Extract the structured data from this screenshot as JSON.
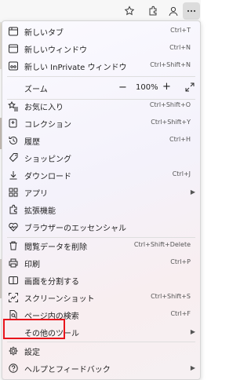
{
  "toolbar": {
    "icons": [
      "favorite-star-icon",
      "extensions-icon",
      "profile-icon",
      "more-menu-icon"
    ]
  },
  "menu": {
    "items": [
      {
        "label": "新しいタブ",
        "shortcut": "Ctrl+T",
        "icon": "new-tab-icon"
      },
      {
        "label": "新しいウィンドウ",
        "shortcut": "Ctrl+N",
        "icon": "new-window-icon"
      },
      {
        "label": "新しい InPrivate ウィンドウ",
        "shortcut": "Ctrl+Shift+N",
        "icon": "inprivate-icon"
      },
      {
        "label": "お気に入り",
        "shortcut": "Ctrl+Shift+O",
        "icon": "favorites-icon"
      },
      {
        "label": "コレクション",
        "shortcut": "Ctrl+Shift+Y",
        "icon": "collections-icon"
      },
      {
        "label": "履歴",
        "shortcut": "Ctrl+H",
        "icon": "history-icon"
      },
      {
        "label": "ショッピング",
        "shortcut": "",
        "icon": "shopping-tag-icon"
      },
      {
        "label": "ダウンロード",
        "shortcut": "Ctrl+J",
        "icon": "download-icon"
      },
      {
        "label": "アプリ",
        "shortcut": "",
        "icon": "apps-icon"
      },
      {
        "label": "拡張機能",
        "shortcut": "",
        "icon": "extensions-icon"
      },
      {
        "label": "ブラウザーのエッセンシャル",
        "shortcut": "",
        "icon": "heart-pulse-icon"
      },
      {
        "label": "閲覧データを削除",
        "shortcut": "Ctrl+Shift+Delete",
        "icon": "trash-icon"
      },
      {
        "label": "印刷",
        "shortcut": "Ctrl+P",
        "icon": "print-icon"
      },
      {
        "label": "画面を分割する",
        "shortcut": "",
        "icon": "split-screen-icon"
      },
      {
        "label": "スクリーンショット",
        "shortcut": "Ctrl+Shift+S",
        "icon": "screenshot-icon"
      },
      {
        "label": "ページ内の検索",
        "shortcut": "Ctrl+F",
        "icon": "find-icon"
      },
      {
        "label": "その他のツール",
        "shortcut": "",
        "icon": ""
      },
      {
        "label": "設定",
        "shortcut": "",
        "icon": "settings-gear-icon"
      },
      {
        "label": "ヘルプとフィードバック",
        "shortcut": "",
        "icon": "help-icon"
      }
    ],
    "zoom": {
      "label": "ズーム",
      "minus": "−",
      "value": "100%",
      "plus": "+"
    }
  },
  "colors": {
    "highlight": "#e8141b",
    "menu_bg": "#f4f2fb"
  }
}
